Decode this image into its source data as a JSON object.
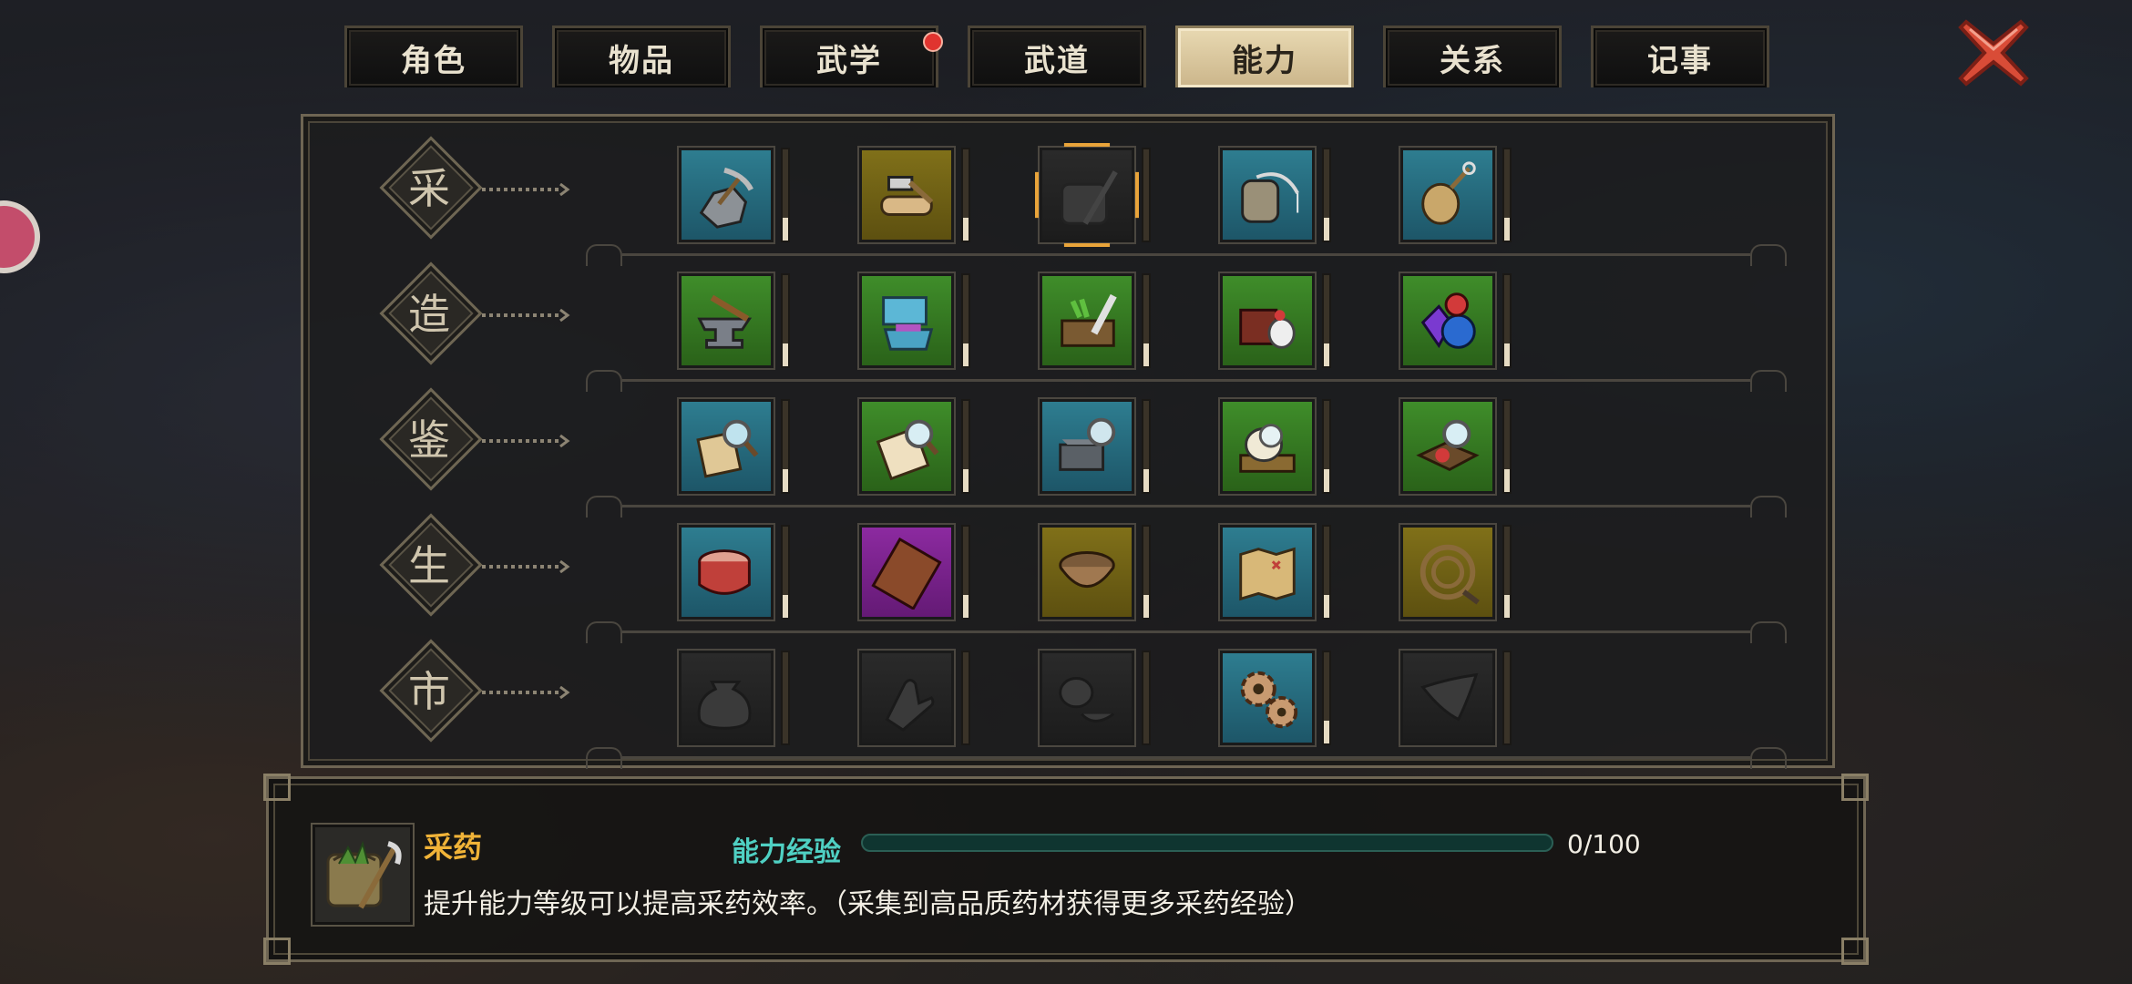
{
  "tabs": [
    {
      "label": "角色",
      "active": false,
      "badge": false
    },
    {
      "label": "物品",
      "active": false,
      "badge": false
    },
    {
      "label": "武学",
      "active": false,
      "badge": true
    },
    {
      "label": "武道",
      "active": false,
      "badge": false
    },
    {
      "label": "能力",
      "active": true,
      "badge": false
    },
    {
      "label": "关系",
      "active": false,
      "badge": false
    },
    {
      "label": "记事",
      "active": false,
      "badge": false
    }
  ],
  "categories": [
    {
      "label": "采",
      "skills": [
        {
          "icon": "ore-pickaxe-icon",
          "color": "blue",
          "level": 0.25,
          "selected": false
        },
        {
          "icon": "axe-log-icon",
          "color": "olive",
          "level": 0.25,
          "selected": false
        },
        {
          "icon": "herb-sickle-icon",
          "color": "dark",
          "level": 0.0,
          "selected": true
        },
        {
          "icon": "fishing-rod-icon",
          "color": "blue",
          "level": 0.25,
          "selected": false
        },
        {
          "icon": "bug-net-icon",
          "color": "blue",
          "level": 0.25,
          "selected": false
        }
      ]
    },
    {
      "label": "造",
      "skills": [
        {
          "icon": "anvil-hammer-icon",
          "color": "green",
          "level": 0.25,
          "selected": false
        },
        {
          "icon": "fabric-loom-icon",
          "color": "green",
          "level": 0.25,
          "selected": false
        },
        {
          "icon": "cooking-knife-icon",
          "color": "green",
          "level": 0.25,
          "selected": false
        },
        {
          "icon": "medicine-box-icon",
          "color": "green",
          "level": 0.25,
          "selected": false
        },
        {
          "icon": "gems-icon",
          "color": "green",
          "level": 0.25,
          "selected": false
        }
      ]
    },
    {
      "label": "鉴",
      "skills": [
        {
          "icon": "scroll-magnifier-icon",
          "color": "blue",
          "level": 0.25,
          "selected": false
        },
        {
          "icon": "book-magnifier-icon",
          "color": "green",
          "level": 0.25,
          "selected": false
        },
        {
          "icon": "chest-magnifier-icon",
          "color": "blue",
          "level": 0.25,
          "selected": false
        },
        {
          "icon": "skull-magnifier-icon",
          "color": "green",
          "level": 0.25,
          "selected": false
        },
        {
          "icon": "gem-magnifier-icon",
          "color": "green",
          "level": 0.25,
          "selected": false
        }
      ]
    },
    {
      "label": "生",
      "skills": [
        {
          "icon": "drum-icon",
          "color": "blue",
          "level": 0.25,
          "selected": false
        },
        {
          "icon": "chocolate-board-icon",
          "color": "purple",
          "level": 0.25,
          "selected": false
        },
        {
          "icon": "bowl-icon",
          "color": "olive",
          "level": 0.25,
          "selected": false
        },
        {
          "icon": "treasure-map-icon",
          "color": "blue",
          "level": 0.25,
          "selected": false
        },
        {
          "icon": "whip-icon",
          "color": "olive",
          "level": 0.25,
          "selected": false
        }
      ]
    },
    {
      "label": "市",
      "skills": [
        {
          "icon": "money-bag-icon",
          "color": "dark",
          "level": 0.0,
          "selected": false
        },
        {
          "icon": "hand-icon",
          "color": "dark",
          "level": 0.0,
          "selected": false
        },
        {
          "icon": "scale-weight-icon",
          "color": "dark",
          "level": 0.0,
          "selected": false
        },
        {
          "icon": "gears-icon",
          "color": "blue",
          "level": 0.25,
          "selected": false
        },
        {
          "icon": "horn-icon",
          "color": "dark",
          "level": 0.0,
          "selected": false
        }
      ]
    }
  ],
  "info": {
    "icon": "herb-sickle-icon",
    "title": "采药",
    "description": "提升能力等级可以提高采药效率。（采集到高品质药材获得更多采药经验）",
    "exp_label": "能力经验",
    "exp_value": "0/100",
    "exp_fraction": 0.0
  },
  "colors": {
    "accent_gold": "#f0b338",
    "exp_teal": "#4fd0c3",
    "selected_frame": "#e9a43a"
  }
}
